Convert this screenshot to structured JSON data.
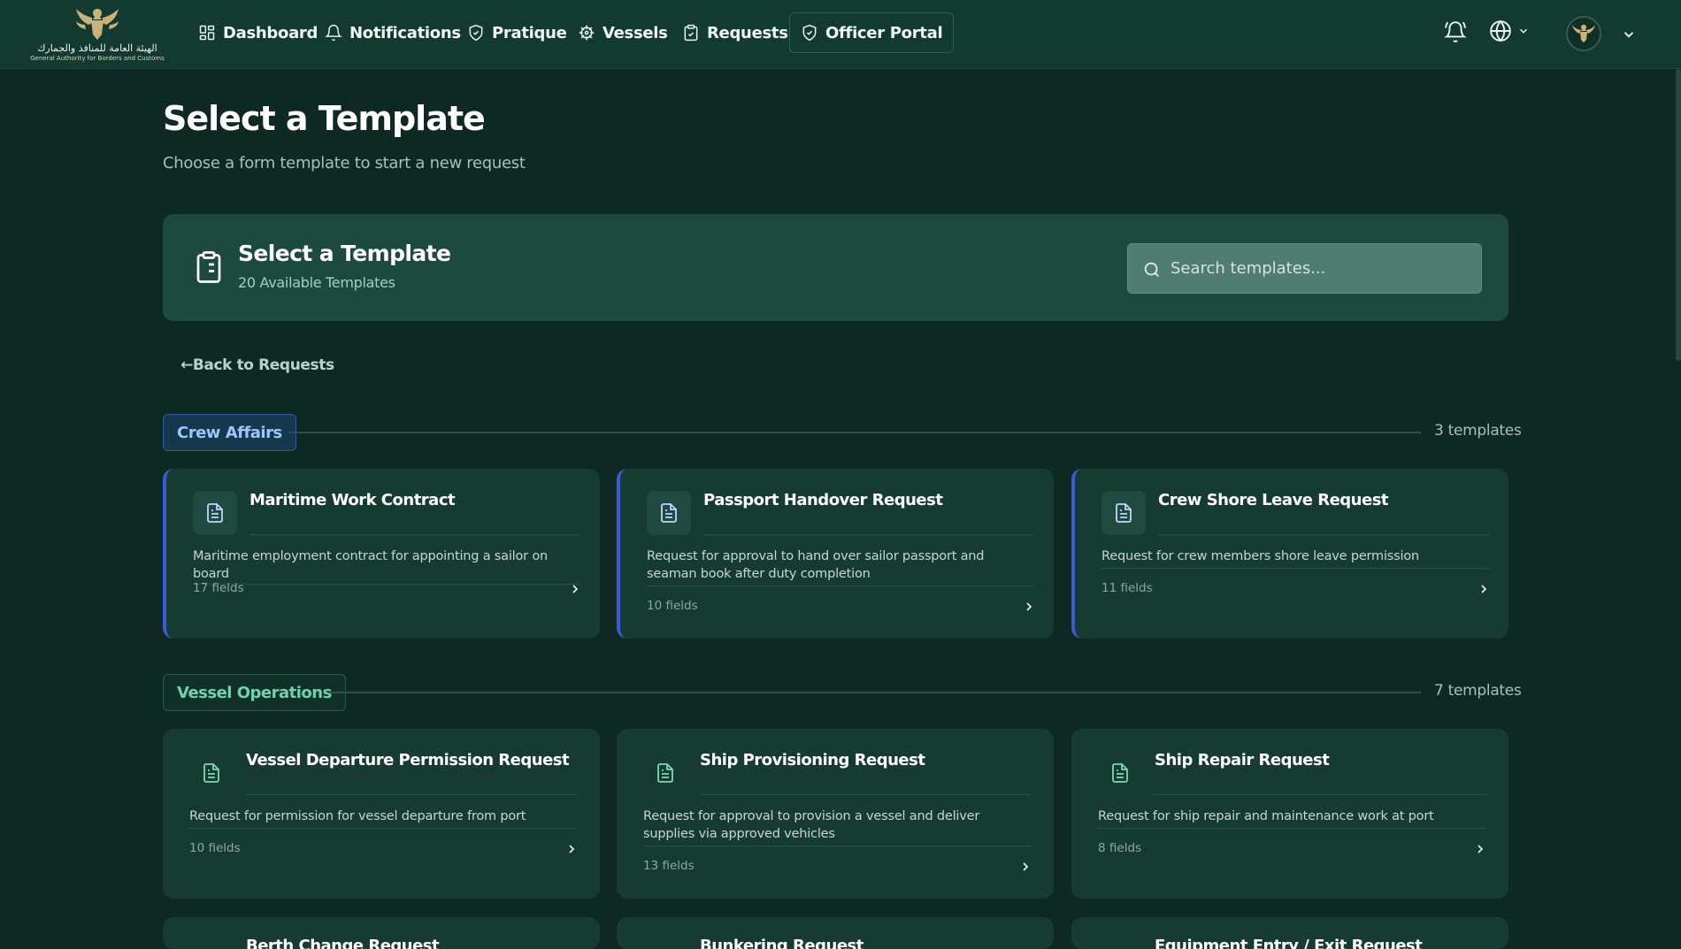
{
  "brand": {
    "arabic_name": "الهيئة العامة للمنافذ والجمارك",
    "english_name": "General Authority for Borders and Customs"
  },
  "nav": {
    "items": [
      {
        "label": "Dashboard",
        "icon": "grid-icon"
      },
      {
        "label": "Notifications",
        "icon": "bell-icon"
      },
      {
        "label": "Pratique",
        "icon": "shield-check-icon"
      },
      {
        "label": "Vessels",
        "icon": "ship-wheel-icon"
      },
      {
        "label": "Requests",
        "icon": "clipboard-check-icon"
      },
      {
        "label": "Officer Portal",
        "icon": "shield-check-icon",
        "active": true
      }
    ]
  },
  "page": {
    "title": "Select a Template",
    "subtitle": "Choose a form template to start a new request"
  },
  "header_card": {
    "title": "Select a Template",
    "subtitle": "20 Available Templates",
    "search_placeholder": "Search templates..."
  },
  "back_link": "←Back to Requests",
  "sections": [
    {
      "name": "Crew Affairs",
      "count": "3 templates",
      "templates": [
        {
          "title": "Maritime Work Contract",
          "description": "Maritime employment contract for appointing a sailor on board",
          "fields": "17 fields"
        },
        {
          "title": "Passport Handover Request",
          "description": "Request for approval to hand over sailor passport and seaman book after duty completion",
          "fields": "10 fields"
        },
        {
          "title": "Crew Shore Leave Request",
          "description": "Request for crew members shore leave permission",
          "fields": "11 fields"
        }
      ]
    },
    {
      "name": "Vessel Operations",
      "count": "7 templates",
      "templates": [
        {
          "title": "Vessel Departure Permission Request",
          "description": "Request for permission for vessel departure from port",
          "fields": "10 fields"
        },
        {
          "title": "Ship Provisioning Request",
          "description": "Request for approval to provision a vessel and deliver supplies via approved vehicles",
          "fields": "13 fields"
        },
        {
          "title": "Ship Repair Request",
          "description": "Request for ship repair and maintenance work at port",
          "fields": "8 fields"
        },
        {
          "title": "Berth Change Request",
          "description": "",
          "fields": ""
        },
        {
          "title": "Bunkering Request",
          "description": "",
          "fields": ""
        },
        {
          "title": "Equipment Entry / Exit Request",
          "description": "",
          "fields": ""
        }
      ]
    }
  ],
  "colors": {
    "background": "#0e2822",
    "nav_bg": "#133a30",
    "card_bg": "#163b31",
    "crew_accent": "#3b5ad6",
    "vessel_accent": "#6fd4ad"
  }
}
